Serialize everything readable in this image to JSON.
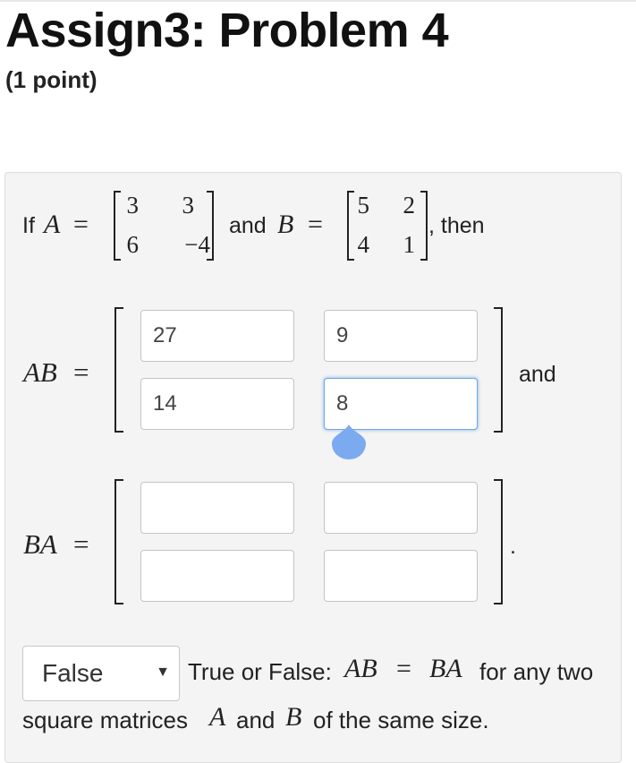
{
  "header": {
    "title": "Assign3: Problem 4",
    "points": "(1 point)"
  },
  "problem": {
    "if_text": "If",
    "A_sym": "A",
    "eq": "=",
    "A_matrix": [
      [
        "3",
        "3"
      ],
      [
        "6",
        "−4"
      ]
    ],
    "and_text": "and",
    "B_sym": "B",
    "B_matrix": [
      [
        "5",
        "2"
      ],
      [
        "4",
        "1"
      ]
    ],
    "then_text": ", then",
    "AB_label": "AB",
    "AB_answers": [
      [
        "27",
        "9"
      ],
      [
        "14",
        "8"
      ]
    ],
    "AB_after": "and",
    "BA_label": "BA",
    "BA_answers": [
      [
        "",
        ""
      ],
      [
        "",
        ""
      ]
    ],
    "BA_after": ".",
    "tf": {
      "selected": "False",
      "q_prefix": "True or False:",
      "q_AB": "AB",
      "q_eq": "=",
      "q_BA": "BA",
      "q_mid": "for any two",
      "q_line2a": "square matrices",
      "q_A": "A",
      "q_and": "and",
      "q_B": "B",
      "q_line2b": "of the same size."
    }
  },
  "colors": {
    "focus_border": "#6ea6e6",
    "cursor_handle": "#7baaf0",
    "panel_bg": "#f4f4f4"
  },
  "icons": {
    "dropdown": "triangle-down-icon",
    "text_cursor": "text-cursor-handle-icon"
  }
}
